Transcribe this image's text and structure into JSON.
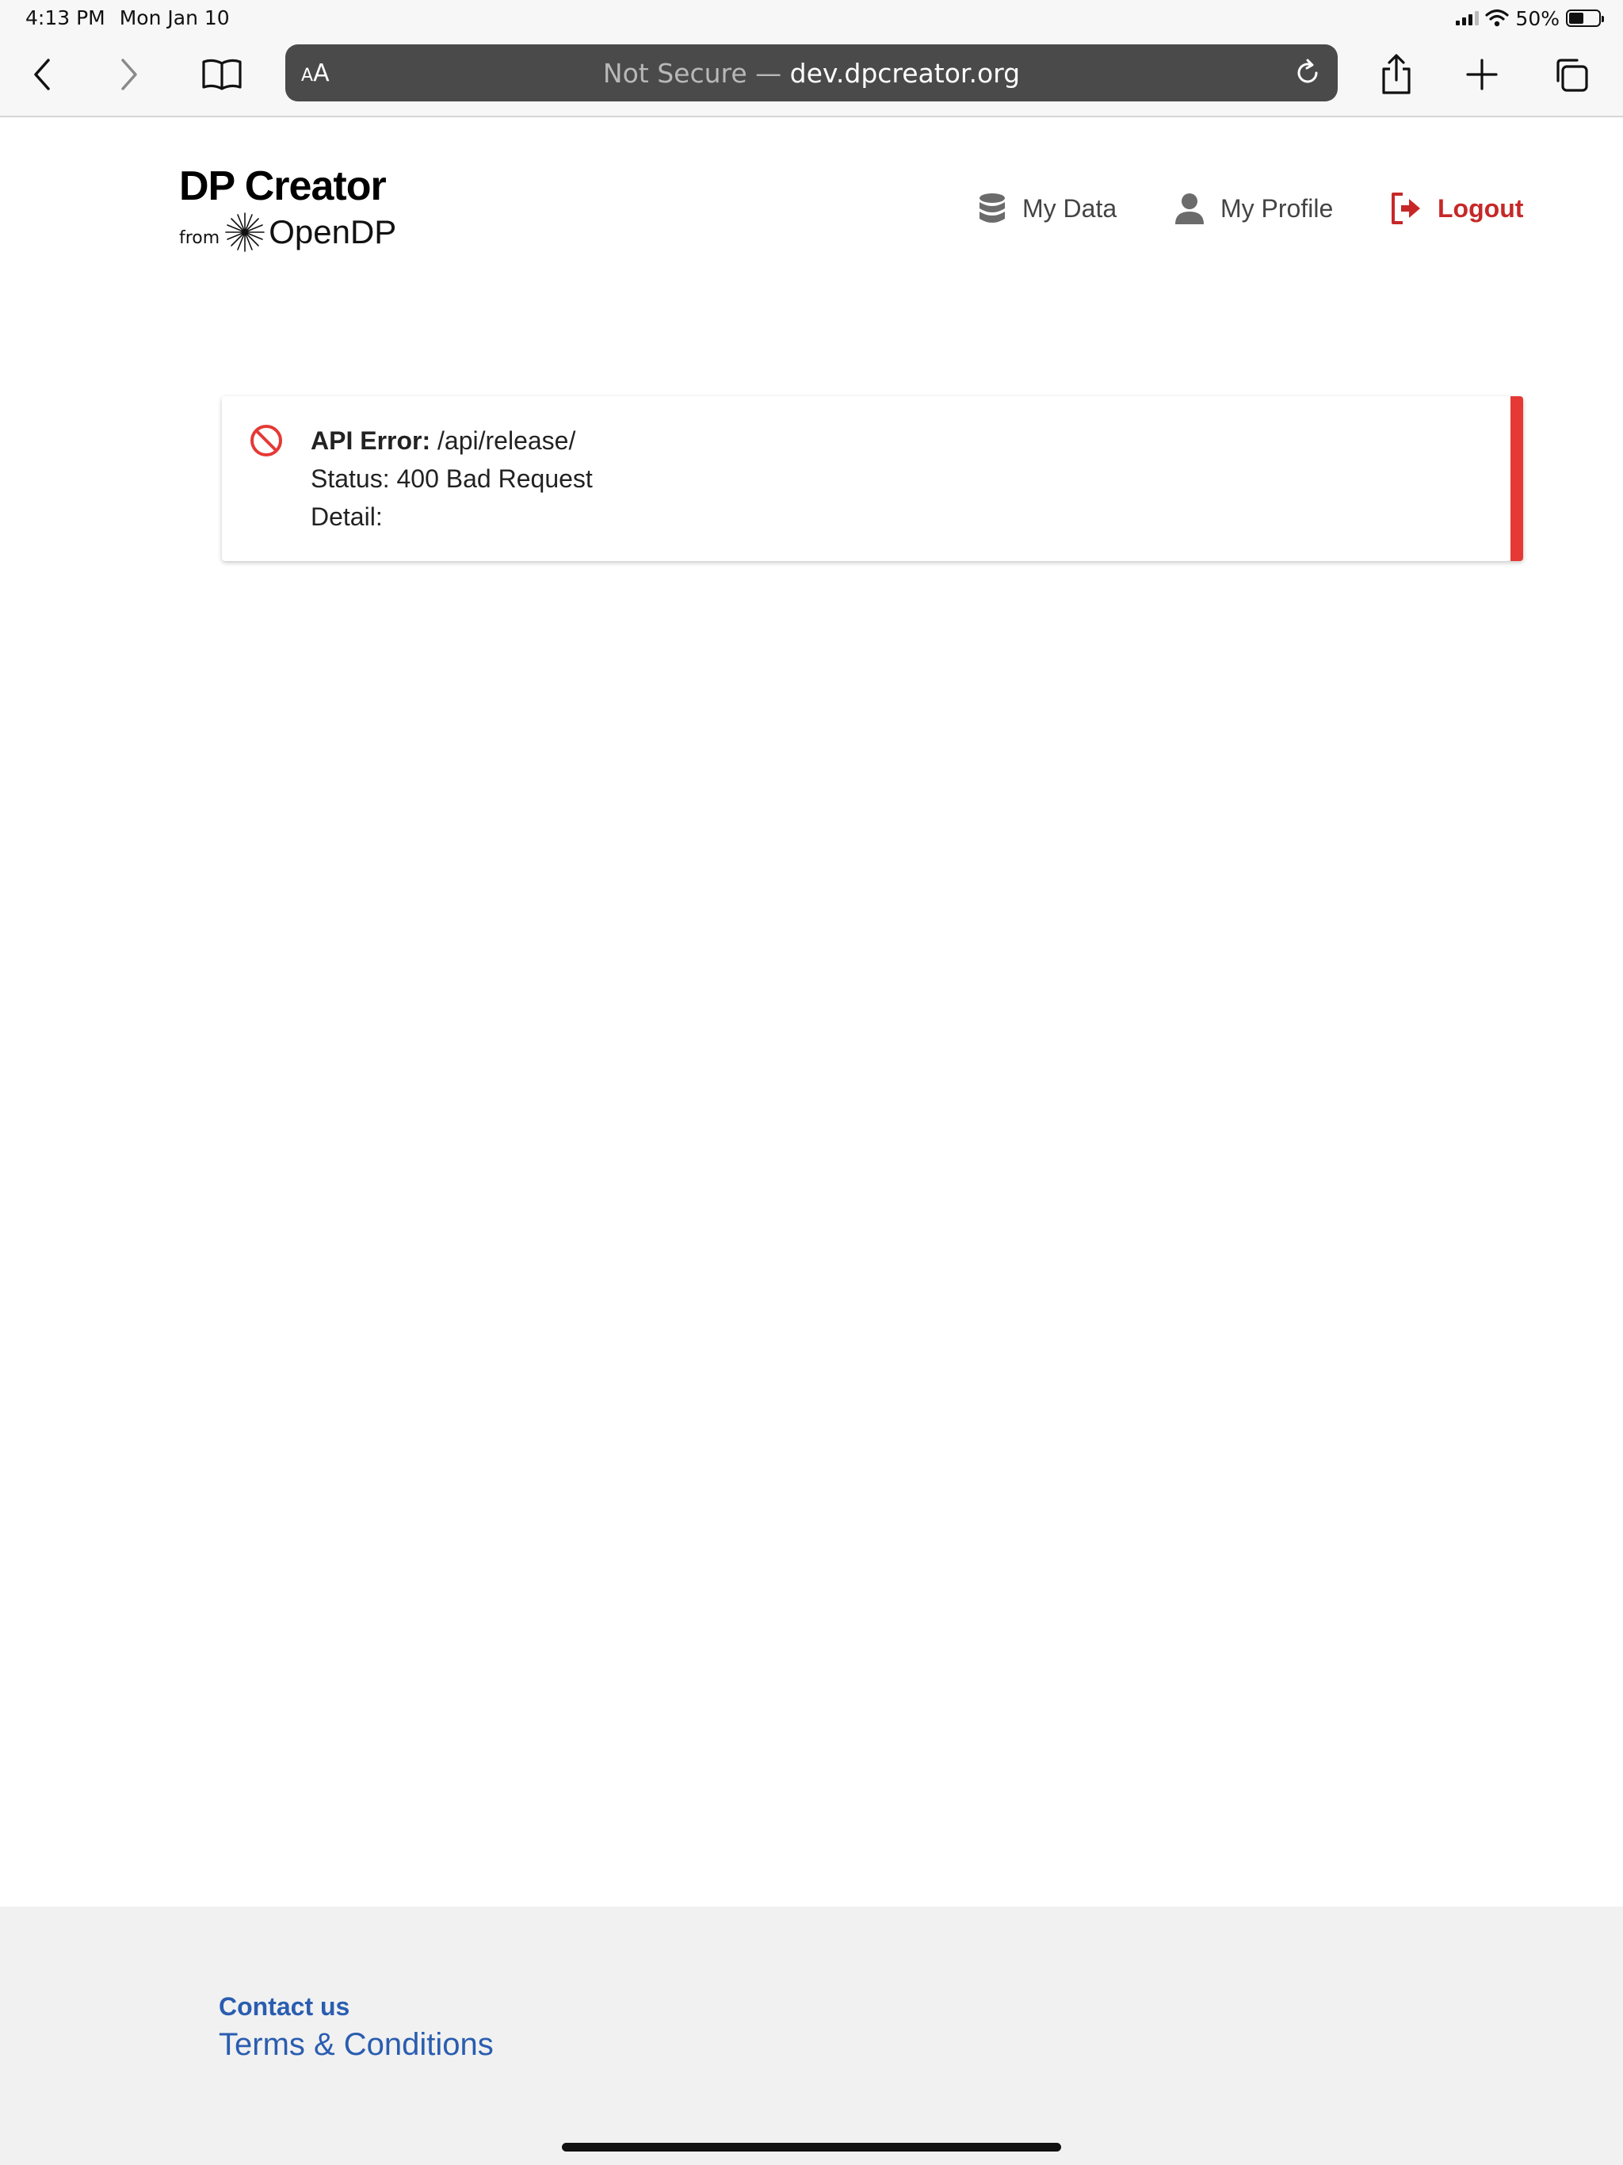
{
  "status_bar": {
    "time": "4:13 PM",
    "date": "Mon Jan 10",
    "battery_percent": "50%",
    "battery_level": 0.5,
    "icons": [
      "signal-icon",
      "wifi-icon",
      "battery-icon"
    ]
  },
  "browser": {
    "text_size_label_big": "A",
    "text_size_label_small": "A",
    "url_insecure_prefix": "Not Secure — ",
    "url_domain": "dev.dpcreator.org",
    "icons": [
      "back-icon",
      "forward-icon",
      "bookmarks-icon",
      "reload-icon",
      "share-icon",
      "new-tab-icon",
      "tabs-icon"
    ]
  },
  "header": {
    "logo_title": "DP Creator",
    "logo_from": "from",
    "logo_org": "OpenDP",
    "nav": [
      {
        "label": "My Data",
        "icon": "database-icon"
      },
      {
        "label": "My Profile",
        "icon": "user-icon"
      },
      {
        "label": "Logout",
        "icon": "logout-icon"
      }
    ],
    "colors": {
      "logout": "#c62828"
    }
  },
  "alert": {
    "title": "API Error:",
    "endpoint": "/api/release/",
    "status_line": "Status: 400 Bad Request",
    "detail_line": "Detail:",
    "icon": "ban-icon",
    "colors": {
      "accent": "#e53935"
    }
  },
  "footer": {
    "contact_label": "Contact us",
    "terms_label": "Terms & Conditions",
    "colors": {
      "link": "#2a5db0"
    }
  }
}
